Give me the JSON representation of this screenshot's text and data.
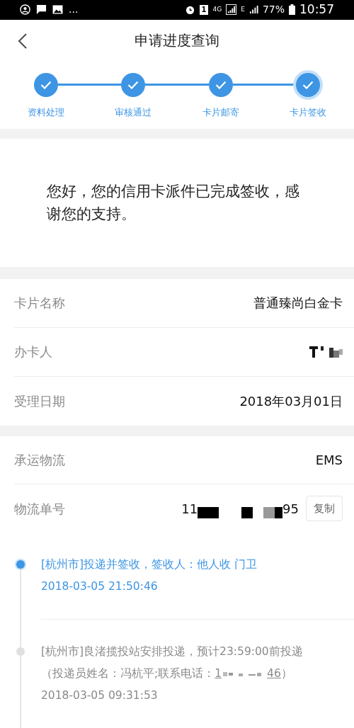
{
  "status_bar": {
    "overflow": "...",
    "sim": "1",
    "network": "4G",
    "network2": "E",
    "battery": "77%",
    "time": "10:57"
  },
  "header": {
    "title": "申请进度查询"
  },
  "steps": [
    {
      "label": "资料处理",
      "done": true,
      "current": false
    },
    {
      "label": "审核通过",
      "done": true,
      "current": false
    },
    {
      "label": "卡片邮寄",
      "done": true,
      "current": false
    },
    {
      "label": "卡片签收",
      "done": true,
      "current": true
    }
  ],
  "message": "您好，您的信用卡派件已完成签收，感谢您的支持。",
  "card_info": [
    {
      "label": "卡片名称",
      "value": "普通臻尚白金卡",
      "redacted": false
    },
    {
      "label": "办卡人",
      "redacted": true
    },
    {
      "label": "受理日期",
      "value": "2018年03月01日",
      "redacted": false
    }
  ],
  "logistics": {
    "carrier_label": "承运物流",
    "carrier": "EMS",
    "number_label": "物流单号",
    "number_start": "11",
    "number_end": "95",
    "copy_button": "复制"
  },
  "timeline": [
    {
      "text": "[杭州市]投递并签收，签收人：他人收 门卫",
      "time": "2018-03-05 21:50:46",
      "selected": true
    },
    {
      "text": "[杭州市]良渚揽投站安排投递，预计23:59:00前投递（投递员姓名：冯杭平;联系电话：",
      "phone_start": "1",
      "phone_end": "46",
      "text_end": "）",
      "time": "2018-03-05 09:31:53",
      "selected": false
    }
  ]
}
